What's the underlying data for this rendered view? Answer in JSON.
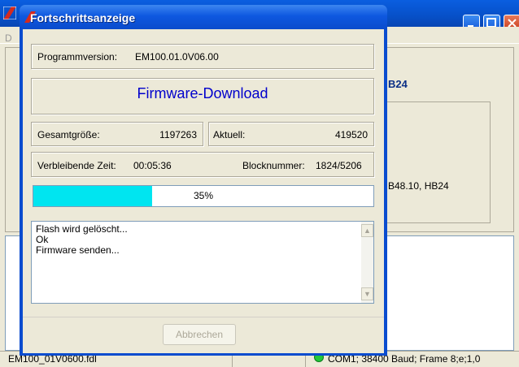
{
  "background_window": {
    "menu_initial": "D",
    "heading": "B24",
    "device_text": "B48.10, HB24",
    "status_file": "EM100_01V0600.fdl",
    "status_connection": "COM1; 38400 Baud; Frame 8;e;1,0"
  },
  "dialog": {
    "title": "Fortschrittsanzeige",
    "version_label": "Programmversion:",
    "version_value": "EM100.01.0V06.00",
    "heading": "Firmware-Download",
    "total_label": "Gesamtgröße:",
    "total_value": "1197263",
    "current_label": "Aktuell:",
    "current_value": "419520",
    "remaining_label": "Verbleibende Zeit:",
    "remaining_value": "00:05:36",
    "block_label": "Blocknummer:",
    "block_value": "1824/5206",
    "progress_percent": 35,
    "progress_text": "35%",
    "log_lines": [
      "Flash wird gelöscht...",
      "Ok",
      "Firmware senden..."
    ],
    "cancel_label": "Abbrechen"
  },
  "colors": {
    "progress_fill": "#00E5F0",
    "heading": "#0000CC",
    "titlebar": "#0A4BCC"
  }
}
